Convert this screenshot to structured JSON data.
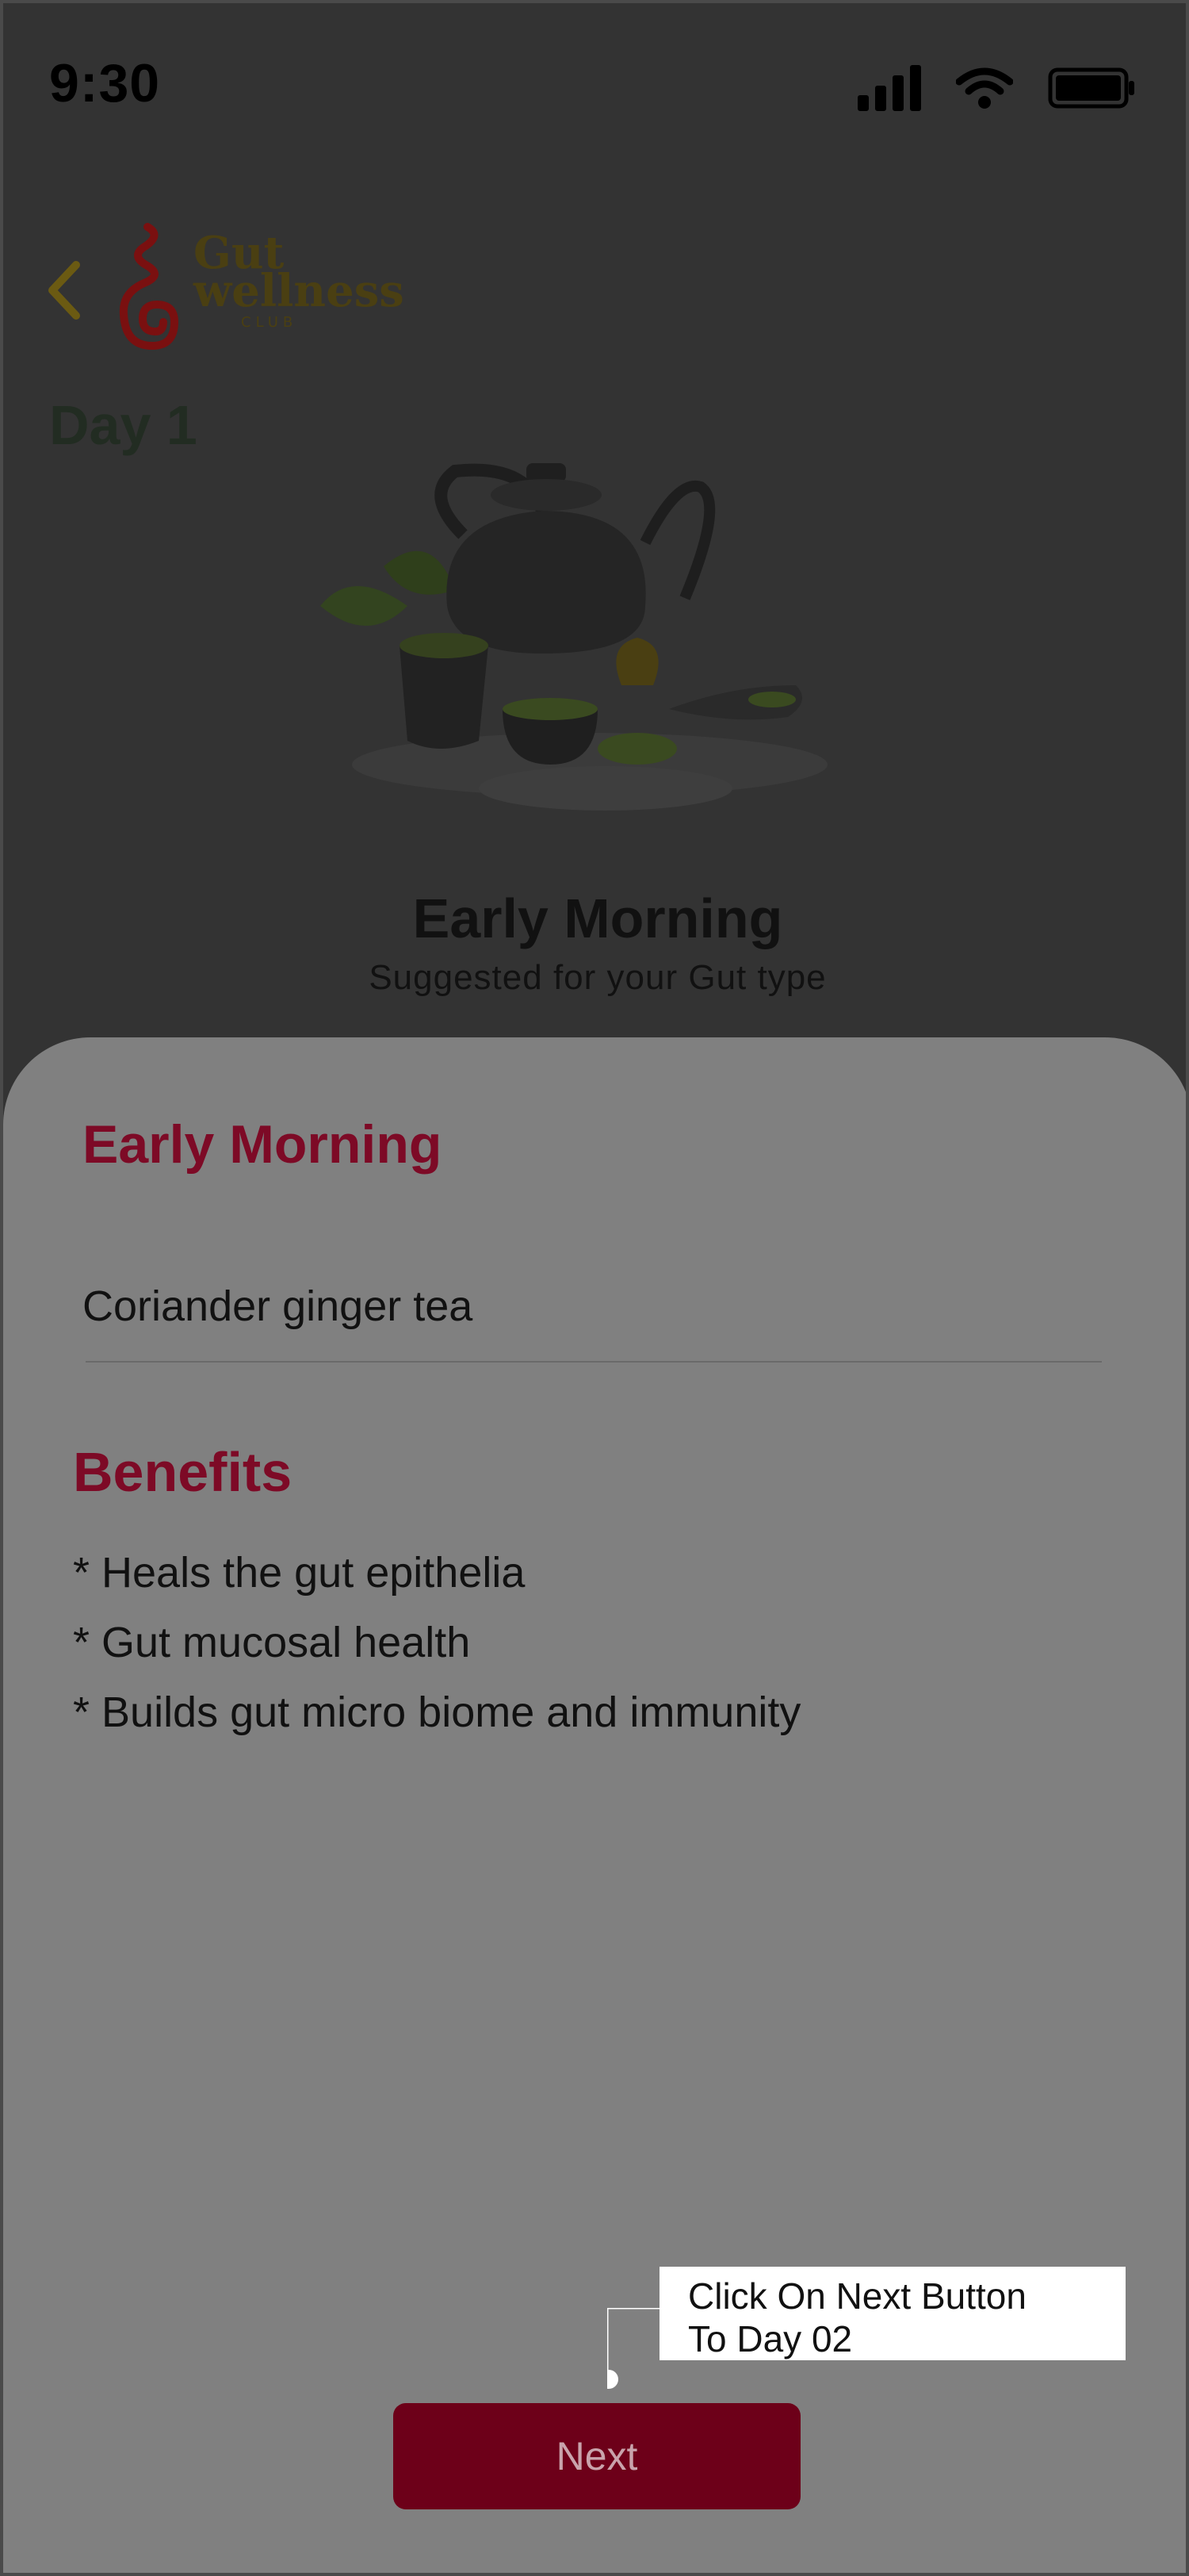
{
  "status_bar": {
    "time": "9:30"
  },
  "header": {
    "logo_line1": "Gut",
    "logo_line2": "wellness",
    "logo_line3": "CLUB",
    "day_title": "Day 1"
  },
  "hero": {
    "title": "Early Morning",
    "subtitle": "Suggested for your Gut type"
  },
  "sheet": {
    "meal_heading": "Early Morning",
    "meal_item": "Coriander ginger tea",
    "benefits_heading": "Benefits",
    "benefits": [
      "* Heals the gut epithelia",
      "* Gut mucosal health",
      "* Builds gut micro biome and immunity"
    ]
  },
  "tooltip": {
    "line1": "Click On Next Button",
    "line2": "To Day 02"
  },
  "next_button": {
    "label": "Next"
  },
  "colors": {
    "accent": "#7d0a26",
    "button": "#6d0019",
    "overlay": "#808080",
    "background": "#333333"
  },
  "icons": [
    "cellular-signal-icon",
    "wifi-icon",
    "battery-icon",
    "back-chevron-icon",
    "gut-wellness-logo"
  ]
}
